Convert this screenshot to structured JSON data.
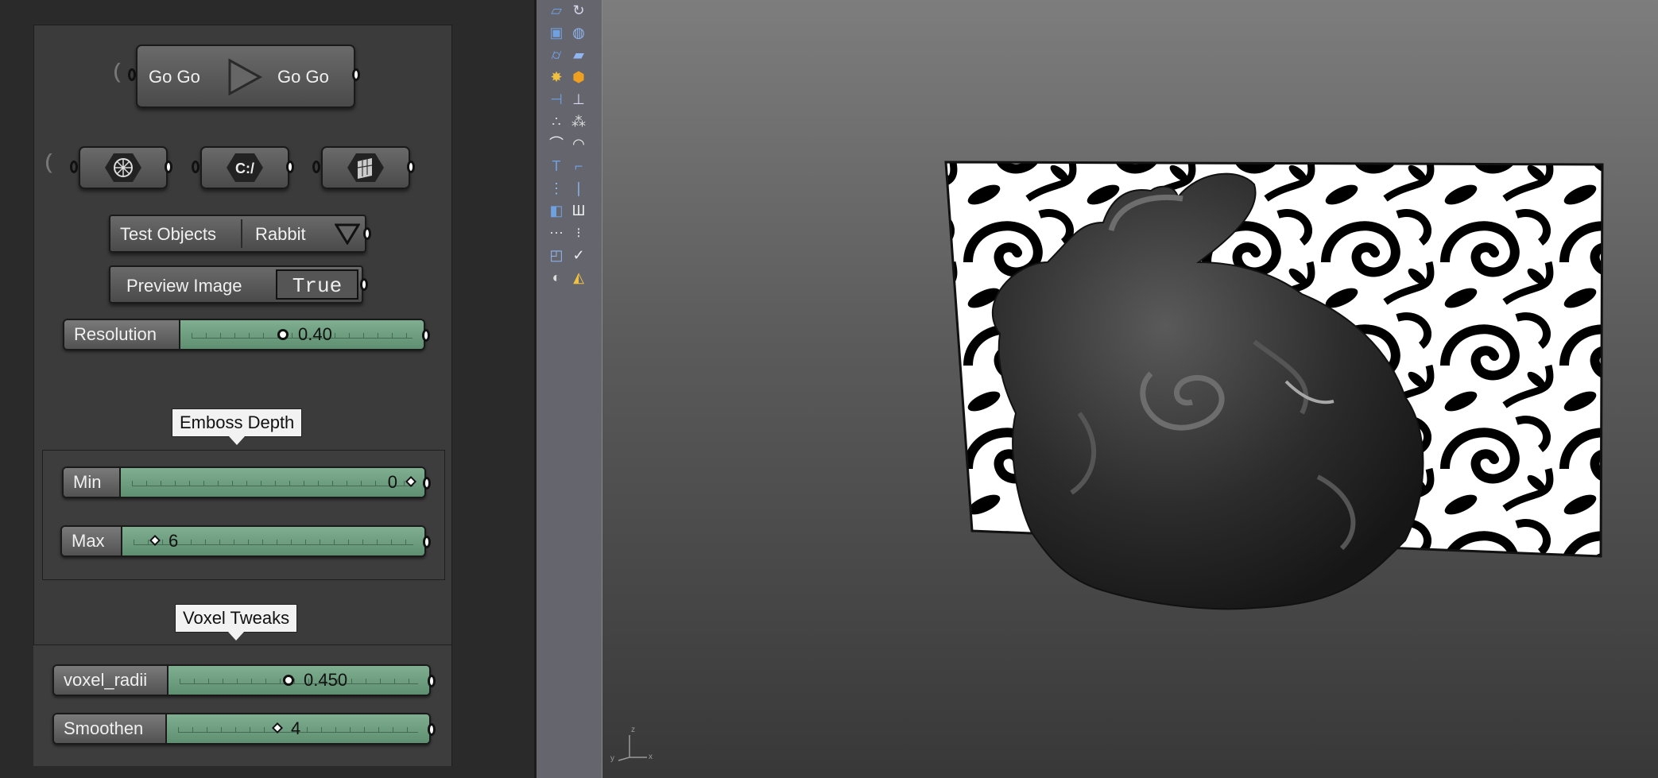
{
  "gh": {
    "go_button": {
      "left_label": "Go Go",
      "right_label": "Go Go"
    },
    "icon_buttons": [
      {
        "icon": "mesh-wheel-icon"
      },
      {
        "icon": "code-path-icon",
        "glyph": "C:/"
      },
      {
        "icon": "mesh-patch-icon"
      }
    ],
    "test_objects": {
      "label": "Test Objects",
      "value": "Rabbit"
    },
    "preview_image": {
      "label": "Preview Image",
      "value": "True"
    },
    "resolution": {
      "label": "Resolution",
      "value": "0.40",
      "fraction": 0.4
    },
    "emboss_group": {
      "title": "Emboss Depth",
      "min": {
        "label": "Min",
        "value": "0"
      },
      "max": {
        "label": "Max",
        "value": "6"
      }
    },
    "voxel_group": {
      "title": "Voxel Tweaks",
      "voxel_radii": {
        "label": "voxel_radii",
        "value": "0.450"
      },
      "smoothen": {
        "label": "Smoothen",
        "value": "4"
      }
    }
  },
  "rhino": {
    "toolbar_icons": [
      "transform-icon",
      "rotate-icon",
      "box-icon",
      "sphere-icon",
      "cylinder-icon",
      "surface-icon",
      "explode-icon",
      "boolean-icon",
      "split-icon",
      "trim-icon",
      "points-icon",
      "network-icon",
      "curve-icon",
      "arc-icon",
      "text-icon",
      "dimension-icon",
      "array-icon",
      "measure-icon",
      "block-icon",
      "layer-icon",
      "grid-icon",
      "properties-icon",
      "mesh-icon",
      "check-icon",
      "analyze-icon",
      "render-icon"
    ],
    "viewport": {
      "axis_labels": {
        "x": "x",
        "y": "y",
        "z": "z"
      },
      "scene": "rabbit-model-with-embossed-pattern",
      "image_plane": "swirl-pattern-image"
    }
  }
}
